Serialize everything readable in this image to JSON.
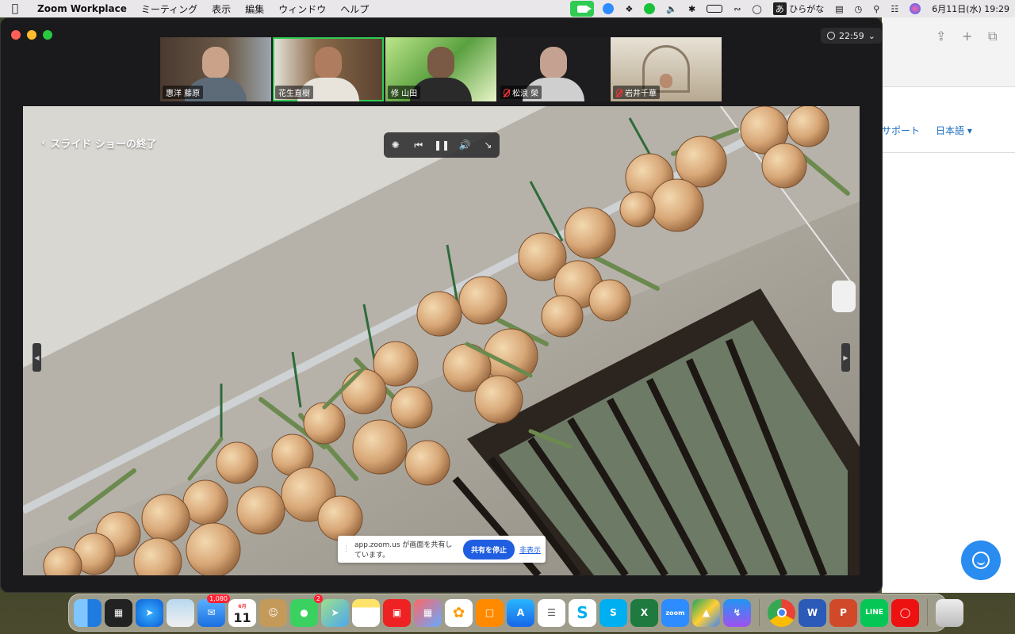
{
  "menubar": {
    "app_name": "Zoom Workplace",
    "menus": [
      "ミーティング",
      "表示",
      "編集",
      "ウィンドウ",
      "ヘルプ"
    ],
    "input_mode_char": "あ",
    "input_mode_label": "ひらがな",
    "datetime": "6月11日(水)  19:29"
  },
  "meeting": {
    "timer": "22:59",
    "end_slideshow": "スライド ショーの終了",
    "participants": [
      {
        "name": "惠洋 藤原",
        "muted": false
      },
      {
        "name": "花生直樹",
        "muted": false
      },
      {
        "name": "修 山田",
        "muted": false
      },
      {
        "name": "松浪 榮",
        "muted": true
      },
      {
        "name": "岩井千華",
        "muted": true
      }
    ],
    "share_bar": {
      "message": "app.zoom.us が画面を共有しています。",
      "stop_label": "共有を停止",
      "hide_label": "非表示"
    }
  },
  "safari": {
    "nav_support": "サポート",
    "nav_language": "日本語 ▾"
  },
  "dock": {
    "mail_badge": "1,080",
    "calendar_month": "6月",
    "calendar_day": "11",
    "messages_badge": "2",
    "zoom_label": "zoom"
  }
}
